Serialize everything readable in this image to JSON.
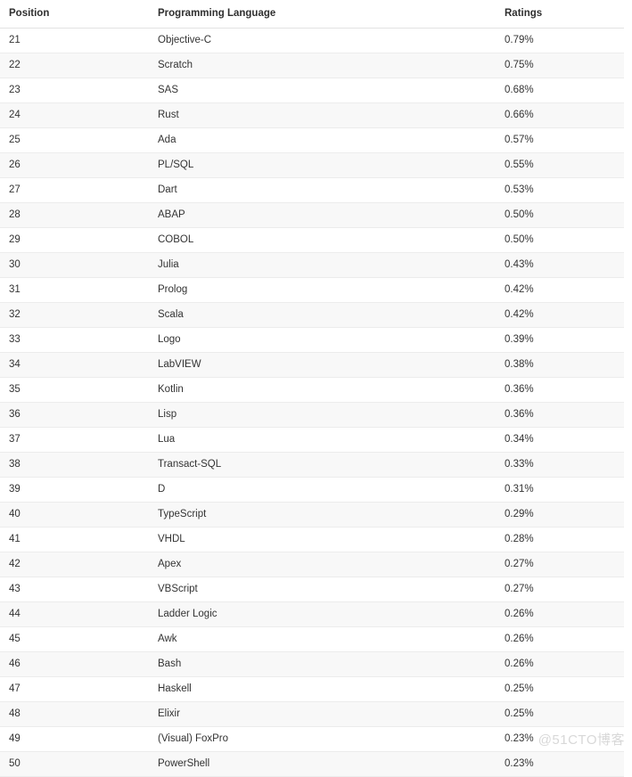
{
  "table": {
    "columns": [
      "Position",
      "Programming Language",
      "Ratings"
    ],
    "rows": [
      {
        "position": "21",
        "language": "Objective-C",
        "rating": "0.79%"
      },
      {
        "position": "22",
        "language": "Scratch",
        "rating": "0.75%"
      },
      {
        "position": "23",
        "language": "SAS",
        "rating": "0.68%"
      },
      {
        "position": "24",
        "language": "Rust",
        "rating": "0.66%"
      },
      {
        "position": "25",
        "language": "Ada",
        "rating": "0.57%"
      },
      {
        "position": "26",
        "language": "PL/SQL",
        "rating": "0.55%"
      },
      {
        "position": "27",
        "language": "Dart",
        "rating": "0.53%"
      },
      {
        "position": "28",
        "language": "ABAP",
        "rating": "0.50%"
      },
      {
        "position": "29",
        "language": "COBOL",
        "rating": "0.50%"
      },
      {
        "position": "30",
        "language": "Julia",
        "rating": "0.43%"
      },
      {
        "position": "31",
        "language": "Prolog",
        "rating": "0.42%"
      },
      {
        "position": "32",
        "language": "Scala",
        "rating": "0.42%"
      },
      {
        "position": "33",
        "language": "Logo",
        "rating": "0.39%"
      },
      {
        "position": "34",
        "language": "LabVIEW",
        "rating": "0.38%"
      },
      {
        "position": "35",
        "language": "Kotlin",
        "rating": "0.36%"
      },
      {
        "position": "36",
        "language": "Lisp",
        "rating": "0.36%"
      },
      {
        "position": "37",
        "language": "Lua",
        "rating": "0.34%"
      },
      {
        "position": "38",
        "language": "Transact-SQL",
        "rating": "0.33%"
      },
      {
        "position": "39",
        "language": "D",
        "rating": "0.31%"
      },
      {
        "position": "40",
        "language": "TypeScript",
        "rating": "0.29%"
      },
      {
        "position": "41",
        "language": "VHDL",
        "rating": "0.28%"
      },
      {
        "position": "42",
        "language": "Apex",
        "rating": "0.27%"
      },
      {
        "position": "43",
        "language": "VBScript",
        "rating": "0.27%"
      },
      {
        "position": "44",
        "language": "Ladder Logic",
        "rating": "0.26%"
      },
      {
        "position": "45",
        "language": "Awk",
        "rating": "0.26%"
      },
      {
        "position": "46",
        "language": "Bash",
        "rating": "0.26%"
      },
      {
        "position": "47",
        "language": "Haskell",
        "rating": "0.25%"
      },
      {
        "position": "48",
        "language": "Elixir",
        "rating": "0.25%"
      },
      {
        "position": "49",
        "language": "(Visual) FoxPro",
        "rating": "0.23%"
      },
      {
        "position": "50",
        "language": "PowerShell",
        "rating": "0.23%"
      }
    ]
  },
  "watermark": {
    "text": "@51CTO博客"
  },
  "colors": {
    "header_text": "#2f2f2f",
    "body_text": "#333333",
    "row_stripe": "#f8f8f8",
    "row_border": "#ececec",
    "header_border": "#e2e2e2",
    "watermark_text": "#d8d8d8"
  }
}
